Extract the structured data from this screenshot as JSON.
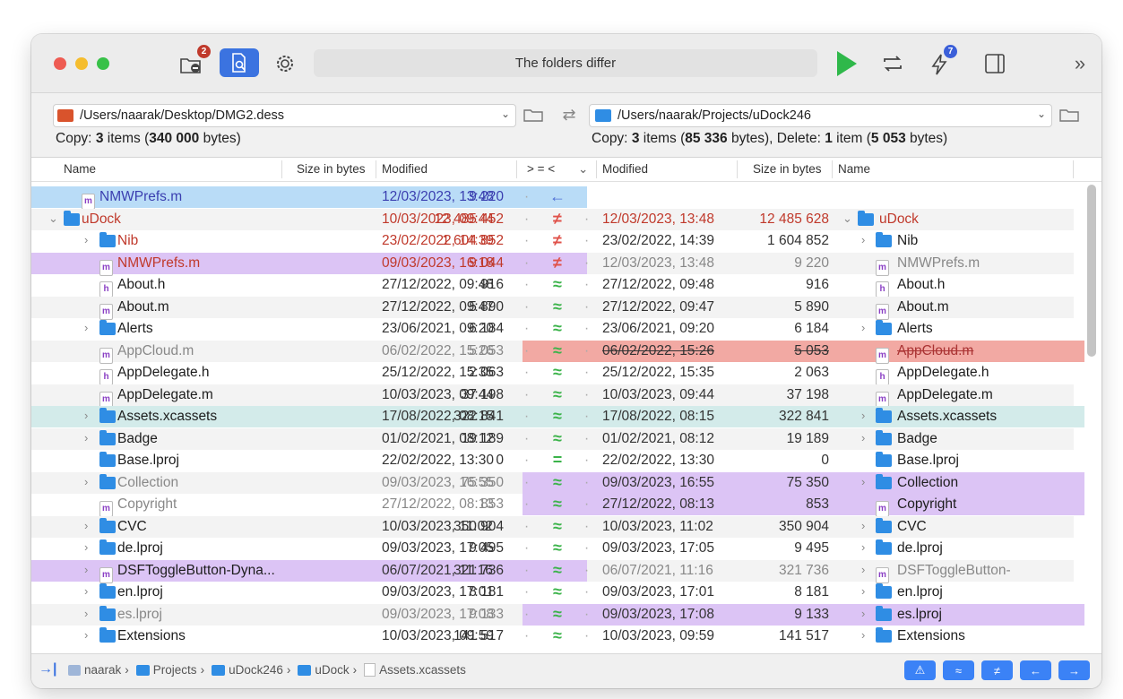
{
  "toolbar": {
    "status_text": "The folders differ",
    "compare_badge": "2",
    "sync_badge": "7"
  },
  "left_path": {
    "path": "/Users/naarak/Desktop/DMG2.dess",
    "summary_prefix": "Copy: ",
    "summary_count": "3",
    "summary_mid": " items (",
    "summary_bytes": "340 000",
    "summary_suffix": " bytes)"
  },
  "right_path": {
    "path": "/Users/naarak/Projects/uDock246",
    "summary_prefix": "Copy: ",
    "summary_count": "3",
    "summary_mid": " items (",
    "summary_bytes": "85 336",
    "summary_mid2": " bytes), Delete: ",
    "summary_del_count": "1",
    "summary_mid3": " item (",
    "summary_del_bytes": "5 053",
    "summary_suffix": " bytes)"
  },
  "columns": {
    "name": "Name",
    "size": "Size in bytes",
    "modified": "Modified",
    "compare": "> = <",
    "modified_r": "Modified",
    "size_r": "Size in bytes",
    "name_r": "Name"
  },
  "rows": [
    {
      "lname": "NMWPrefs.m",
      "lsize": "9 220",
      "ldate": "12/03/2023, 13:48",
      "op": "←",
      "rdate": "",
      "rsize": "",
      "rname": ""
    },
    {
      "lname": "uDock",
      "lsize": "12 485 452",
      "ldate": "10/03/2023, 09:44",
      "op": "≠",
      "rdate": "12/03/2023, 13:48",
      "rsize": "12 485 628",
      "rname": "uDock"
    },
    {
      "lname": "Nib",
      "lsize": "1 604 852",
      "ldate": "23/02/2022, 14:39",
      "op": "≠",
      "rdate": "23/02/2022, 14:39",
      "rsize": "1 604 852",
      "rname": "Nib"
    },
    {
      "lname": "NMWPrefs.m",
      "lsize": "9 044",
      "ldate": "09/03/2023, 16:18",
      "op": "≠",
      "rdate": "12/03/2023, 13:48",
      "rsize": "9 220",
      "rname": "NMWPrefs.m"
    },
    {
      "lname": "About.h",
      "lsize": "916",
      "ldate": "27/12/2022, 09:48",
      "op": "≈",
      "rdate": "27/12/2022, 09:48",
      "rsize": "916",
      "rname": "About.h"
    },
    {
      "lname": "About.m",
      "lsize": "5 890",
      "ldate": "27/12/2022, 09:47",
      "op": "≈",
      "rdate": "27/12/2022, 09:47",
      "rsize": "5 890",
      "rname": "About.m"
    },
    {
      "lname": "Alerts",
      "lsize": "6 184",
      "ldate": "23/06/2021, 09:20",
      "op": "≈",
      "rdate": "23/06/2021, 09:20",
      "rsize": "6 184",
      "rname": "Alerts"
    },
    {
      "lname": "AppCloud.m",
      "lsize": "5 053",
      "ldate": "06/02/2022, 15:26",
      "op": "≈",
      "rdate": "06/02/2022, 15:26",
      "rsize": "5 053",
      "rname": "AppCloud.m"
    },
    {
      "lname": "AppDelegate.h",
      "lsize": "2 063",
      "ldate": "25/12/2022, 15:35",
      "op": "≈",
      "rdate": "25/12/2022, 15:35",
      "rsize": "2 063",
      "rname": "AppDelegate.h"
    },
    {
      "lname": "AppDelegate.m",
      "lsize": "37 198",
      "ldate": "10/03/2023, 09:44",
      "op": "≈",
      "rdate": "10/03/2023, 09:44",
      "rsize": "37 198",
      "rname": "AppDelegate.m"
    },
    {
      "lname": "Assets.xcassets",
      "lsize": "322 841",
      "ldate": "17/08/2022, 08:15",
      "op": "≈",
      "rdate": "17/08/2022, 08:15",
      "rsize": "322 841",
      "rname": "Assets.xcassets"
    },
    {
      "lname": "Badge",
      "lsize": "19 189",
      "ldate": "01/02/2021, 08:12",
      "op": "≈",
      "rdate": "01/02/2021, 08:12",
      "rsize": "19 189",
      "rname": "Badge"
    },
    {
      "lname": "Base.lproj",
      "lsize": "0",
      "ldate": "22/02/2022, 13:30",
      "op": "=",
      "rdate": "22/02/2022, 13:30",
      "rsize": "0",
      "rname": "Base.lproj"
    },
    {
      "lname": "Collection",
      "lsize": "75 350",
      "ldate": "09/03/2023, 16:55",
      "op": "≈",
      "rdate": "09/03/2023, 16:55",
      "rsize": "75 350",
      "rname": "Collection"
    },
    {
      "lname": "Copyright",
      "lsize": "853",
      "ldate": "27/12/2022, 08:13",
      "op": "≈",
      "rdate": "27/12/2022, 08:13",
      "rsize": "853",
      "rname": "Copyright"
    },
    {
      "lname": "CVC",
      "lsize": "350 904",
      "ldate": "10/03/2023, 11:02",
      "op": "≈",
      "rdate": "10/03/2023, 11:02",
      "rsize": "350 904",
      "rname": "CVC"
    },
    {
      "lname": "de.lproj",
      "lsize": "9 495",
      "ldate": "09/03/2023, 17:05",
      "op": "≈",
      "rdate": "09/03/2023, 17:05",
      "rsize": "9 495",
      "rname": "de.lproj"
    },
    {
      "lname": "DSFToggleButton-Dyna...",
      "lsize": "321 736",
      "ldate": "06/07/2021, 11:16",
      "op": "≈",
      "rdate": "06/07/2021, 11:16",
      "rsize": "321 736",
      "rname": "DSFToggleButton-"
    },
    {
      "lname": "en.lproj",
      "lsize": "8 181",
      "ldate": "09/03/2023, 17:01",
      "op": "≈",
      "rdate": "09/03/2023, 17:01",
      "rsize": "8 181",
      "rname": "en.lproj"
    },
    {
      "lname": "es.lproj",
      "lsize": "9 133",
      "ldate": "09/03/2023, 17:08",
      "op": "≈",
      "rdate": "09/03/2023, 17:08",
      "rsize": "9 133",
      "rname": "es.lproj"
    },
    {
      "lname": "Extensions",
      "lsize": "141 517",
      "ldate": "10/03/2023, 09:59",
      "op": "≈",
      "rdate": "10/03/2023, 09:59",
      "rsize": "141 517",
      "rname": "Extensions"
    }
  ],
  "breadcrumb": {
    "items": [
      "naarak",
      "Projects",
      "uDock246",
      "uDock",
      "Assets.xcassets"
    ],
    "sep": "›"
  },
  "filters": [
    "⚠",
    "≈",
    "≠",
    "←",
    "→"
  ],
  "colors": {
    "blue_row": "#b9dcf7",
    "purple_row": "#dcc4f5",
    "red_row": "#f2a9a3",
    "teal_row": "#d3ebea",
    "accent": "#3b82f6",
    "play": "#2fb84a"
  }
}
